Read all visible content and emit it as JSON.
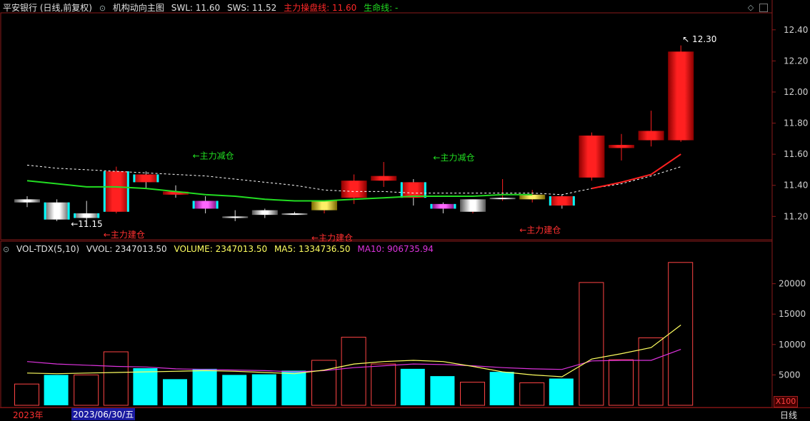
{
  "price_header": {
    "title": "平安银行 (日线,前复权)",
    "indicator": "机构动向主图",
    "swl": "SWL: 11.60",
    "sws": "SWS: 11.52",
    "main_line": "主力操盘线: 11.60",
    "life_line": "生命线: -"
  },
  "volume_header": {
    "title": "VOL-TDX(5,10)",
    "vvol": "VVOL: 2347013.50",
    "volume": "VOLUME: 2347013.50",
    "ma5": "MA5: 1334736.50",
    "ma10": "MA10: 906735.94"
  },
  "footer": {
    "year": "2023年",
    "date": "2023/06/30/五",
    "period": "日线",
    "vol_unit": "X100"
  },
  "colors": {
    "up": "#ff2020",
    "down": "#00ffff",
    "ma_green": "#22dd22",
    "ma_white": "#ffffff",
    "vol_ma5": "#ffff60",
    "vol_ma10": "#dd33dd",
    "frame": "#8a1a1a"
  },
  "chart_data": [
    {
      "type": "candlestick",
      "ylim": [
        11.05,
        12.5
      ],
      "y_ticks": [
        "12.40",
        "12.20",
        "12.00",
        "11.80",
        "11.60",
        "11.40",
        "11.20"
      ],
      "candles": [
        {
          "o": 11.31,
          "h": 11.33,
          "l": 11.26,
          "c": 11.29
        },
        {
          "o": 11.29,
          "h": 11.31,
          "l": 11.17,
          "c": 11.18
        },
        {
          "o": 11.22,
          "h": 11.3,
          "l": 11.15,
          "c": 11.19
        },
        {
          "o": 11.23,
          "h": 11.52,
          "l": 11.22,
          "c": 11.49
        },
        {
          "o": 11.47,
          "h": 11.49,
          "l": 11.38,
          "c": 11.42
        },
        {
          "o": 11.36,
          "h": 11.4,
          "l": 11.32,
          "c": 11.34
        },
        {
          "o": 11.3,
          "h": 11.33,
          "l": 11.22,
          "c": 11.25
        },
        {
          "o": 11.2,
          "h": 11.24,
          "l": 11.17,
          "c": 11.19
        },
        {
          "o": 11.24,
          "h": 11.25,
          "l": 11.19,
          "c": 11.21
        },
        {
          "o": 11.22,
          "h": 11.23,
          "l": 11.21,
          "c": 11.21
        },
        {
          "o": 11.24,
          "h": 11.3,
          "l": 11.22,
          "c": 11.3
        },
        {
          "o": 11.32,
          "h": 11.47,
          "l": 11.28,
          "c": 11.43
        },
        {
          "o": 11.43,
          "h": 11.55,
          "l": 11.39,
          "c": 11.46
        },
        {
          "o": 11.42,
          "h": 11.44,
          "l": 11.27,
          "c": 11.32
        },
        {
          "o": 11.28,
          "h": 11.29,
          "l": 11.22,
          "c": 11.25
        },
        {
          "o": 11.23,
          "h": 11.31,
          "l": 11.22,
          "c": 11.31
        },
        {
          "o": 11.32,
          "h": 11.44,
          "l": 11.3,
          "c": 11.32
        },
        {
          "o": 11.31,
          "h": 11.37,
          "l": 11.29,
          "c": 11.34
        },
        {
          "o": 11.33,
          "h": 11.34,
          "l": 11.25,
          "c": 11.27
        },
        {
          "o": 11.45,
          "h": 11.74,
          "l": 11.43,
          "c": 11.72
        },
        {
          "o": 11.64,
          "h": 11.73,
          "l": 11.56,
          "c": 11.66
        },
        {
          "o": 11.69,
          "h": 11.88,
          "l": 11.65,
          "c": 11.75
        },
        {
          "o": 11.69,
          "h": 12.3,
          "l": 11.68,
          "c": 12.26
        }
      ],
      "ma_green": [
        11.43,
        11.41,
        11.39,
        11.39,
        11.38,
        11.36,
        11.34,
        11.33,
        11.31,
        11.3,
        11.3,
        11.31,
        11.32,
        11.33,
        11.33,
        11.33,
        11.34,
        11.34,
        null,
        11.38,
        11.42,
        11.47,
        11.6
      ],
      "ma_white": [
        11.53,
        11.51,
        11.5,
        11.49,
        11.48,
        11.47,
        11.46,
        11.44,
        11.42,
        11.4,
        11.37,
        11.36,
        11.36,
        11.35,
        11.35,
        11.35,
        11.35,
        11.35,
        11.34,
        11.38,
        11.41,
        11.46,
        11.52
      ],
      "annotations": [
        {
          "label": "11.15",
          "type": "low"
        },
        {
          "label": "←主力建仓",
          "type": "buy"
        },
        {
          "label": "←主力减仓",
          "type": "sell"
        },
        {
          "label": "←主力建仓",
          "type": "buy"
        },
        {
          "label": "←主力减仓",
          "type": "sell"
        },
        {
          "label": "←主力建仓",
          "type": "buy"
        },
        {
          "label": "12.30",
          "type": "high"
        }
      ]
    },
    {
      "type": "bar",
      "ylim": [
        0,
        25000
      ],
      "y_ticks": [
        "20000",
        "15000",
        "10000",
        "5000"
      ],
      "values": [
        3500,
        5000,
        5000,
        8800,
        6100,
        4300,
        6000,
        5000,
        5100,
        5700,
        7400,
        11200,
        6800,
        6000,
        4800,
        3800,
        5500,
        3700,
        4400,
        20200,
        7500,
        11100,
        23500
      ],
      "colors": [
        "up",
        "down",
        "up",
        "up",
        "down",
        "down",
        "down",
        "down",
        "down",
        "down",
        "up",
        "up",
        "up",
        "down",
        "down",
        "up",
        "down",
        "up",
        "down",
        "up",
        "up",
        "up",
        "up"
      ],
      "ma5": [
        5300,
        5200,
        5300,
        5400,
        5500,
        5600,
        5700,
        5600,
        5400,
        5200,
        5800,
        6800,
        7200,
        7400,
        7200,
        6400,
        5500,
        5000,
        4700,
        7600,
        8500,
        9500,
        13200
      ],
      "ma10": [
        7200,
        6800,
        6600,
        6400,
        6300,
        6000,
        5900,
        5800,
        5700,
        5500,
        5700,
        6200,
        6500,
        6800,
        6700,
        6500,
        6200,
        6000,
        5900,
        7300,
        7400,
        7400,
        9200
      ]
    }
  ]
}
